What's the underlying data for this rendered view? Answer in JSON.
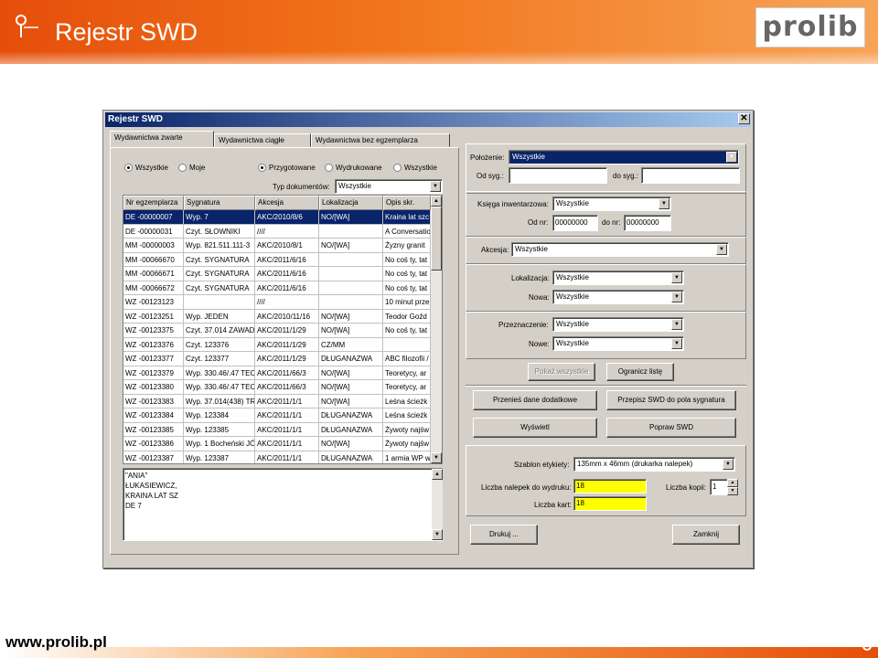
{
  "slide": {
    "title": "Rejestr SWD",
    "url": "www.prolib.pl",
    "logo": "prolib"
  },
  "window": {
    "title": "Rejestr SWD",
    "tabs": [
      "Wydawnictwa zwarte",
      "Wydawnictwa ciągłe",
      "Wydawnictwa bez egzemplarza"
    ],
    "radio_owner": {
      "all": "Wszystkie",
      "mine": "Moje",
      "selected": "all"
    },
    "radio_status": {
      "prepared": "Przygotowane",
      "printed": "Wydrukowane",
      "all": "Wszystkie",
      "selected": "prepared"
    },
    "doc_type_label": "Typ dokumentów:",
    "doc_type_value": "Wszystkie",
    "grid": {
      "columns": [
        "Nr egzemplarza",
        "Sygnatura",
        "Akcesja",
        "Lokalizacja",
        "Opis skr."
      ],
      "rows": [
        [
          "DE -00000007",
          "Wyp. 7",
          "AKC/2010/8/6",
          "NO/[WA]",
          "Kraina lat szc"
        ],
        [
          "DE -00000031",
          "Czyt. SŁOWNIKI",
          "////",
          "",
          "A Conversatio"
        ],
        [
          "MM -00000003",
          "Wyp. 821.511.111-3",
          "AKC/2010/8/1",
          "NO/[WA]",
          "Żyzny granit"
        ],
        [
          "MM -00066670",
          "Czyt. SYGNATURA",
          "AKC/2011/6/16",
          "",
          "No coś ty, tat"
        ],
        [
          "MM -00066671",
          "Czyt. SYGNATURA",
          "AKC/2011/6/16",
          "",
          "No coś ty, tat"
        ],
        [
          "MM -00066672",
          "Czyt. SYGNATURA",
          "AKC/2011/6/16",
          "",
          "No coś ty, tat"
        ],
        [
          "WZ -00123123",
          "",
          "////",
          "",
          "10 minut prze"
        ],
        [
          "WZ -00123251",
          "Wyp. JEDEN",
          "AKC/2010/11/16",
          "NO/[WA]",
          "Teodor Goźd"
        ],
        [
          "WZ -00123375",
          "Czyt. 37.014 ZAWAD",
          "AKC/2011/1/29",
          "NO/[WA]",
          "No coś ty, tat"
        ],
        [
          "WZ -00123376",
          "Czyt. 123376",
          "AKC/2011/1/29",
          "CZ/MM",
          ""
        ],
        [
          "WZ -00123377",
          "Czyt. 123377",
          "AKC/2011/1/29",
          "DŁUGANAZWA",
          "ABC filozofii /"
        ],
        [
          "WZ -00123379",
          "Wyp. 330.46/.47 TEC",
          "AKC/2011/66/3",
          "NO/[WA]",
          "Teoretycy, ar"
        ],
        [
          "WZ -00123380",
          "Wyp. 330.46/.47 TEC",
          "AKC/2011/66/3",
          "NO/[WA]",
          "Teoretycy, ar"
        ],
        [
          "WZ -00123383",
          "Wyp. 37.014(438) TR",
          "AKC/2011/1/1",
          "NO/[WA]",
          "Leśna ścieżk"
        ],
        [
          "WZ -00123384",
          "Wyp. 123384",
          "AKC/2011/1/1",
          "DŁUGANAZWA",
          "Leśna ścieżk"
        ],
        [
          "WZ -00123385",
          "Wyp. 123385",
          "AKC/2011/1/1",
          "DŁUGANAZWA",
          "Żywoty najśw"
        ],
        [
          "WZ -00123386",
          "Wyp. 1 Bocheński JÓ",
          "AKC/2011/1/1",
          "NO/[WA]",
          "Żywoty najśw"
        ],
        [
          "WZ -00123387",
          "Wyp. 123387",
          "AKC/2011/1/1",
          "DŁUGANAZWA",
          "1 armia WP w"
        ]
      ]
    },
    "memo": [
      "\"ANIA\"",
      "ŁUKASIEWICZ,",
      "KRAINA LAT SZ",
      "DE 7"
    ],
    "right": {
      "polozenie_label": "Położenie:",
      "polozenie_value": "Wszystkie",
      "od_syg_label": "Od syg.:",
      "do_syg_label": "do syg.:",
      "ksiega_label": "Księga inwentarzowa:",
      "ksiega_value": "Wszystkie",
      "od_nr_label": "Od nr:",
      "od_nr_value": "00000000",
      "do_nr_label": "do nr:",
      "do_nr_value": "00000000",
      "akcesja_label": "Akcesja:",
      "akcesja_value": "Wszystkie",
      "lokalizacja_label": "Lokalizacja:",
      "lokalizacja_value": "Wszystkie",
      "nowa1_label": "Nowa:",
      "nowa1_value": "Wszystkie",
      "przeznaczenie_label": "Przeznaczenie:",
      "przeznaczenie_value": "Wszystkie",
      "nowe2_label": "Nowe:",
      "nowe2_value": "Wszystkie",
      "btn_show_all": "Pokaż wszystkie",
      "btn_limit": "Ogranicz listę",
      "btn_move": "Przenieś dane dodatkowe",
      "btn_rewrite": "Przepisz SWD do pola sygnatura",
      "btn_display": "Wyświetl",
      "btn_fix": "Popraw SWD",
      "szablon_label": "Szablon etykiety:",
      "szablon_value": "135mm x 46mm (drukarka nalepek)",
      "nalepek_label": "Liczba nalepek do wydruku:",
      "nalepek_value": "18",
      "kopii_label": "Liczba kopii:",
      "kopii_value": "1",
      "kart_label": "Liczba kart:",
      "kart_value": "18",
      "btn_print": "Drukuj ...",
      "btn_close": "Zamknij"
    }
  }
}
